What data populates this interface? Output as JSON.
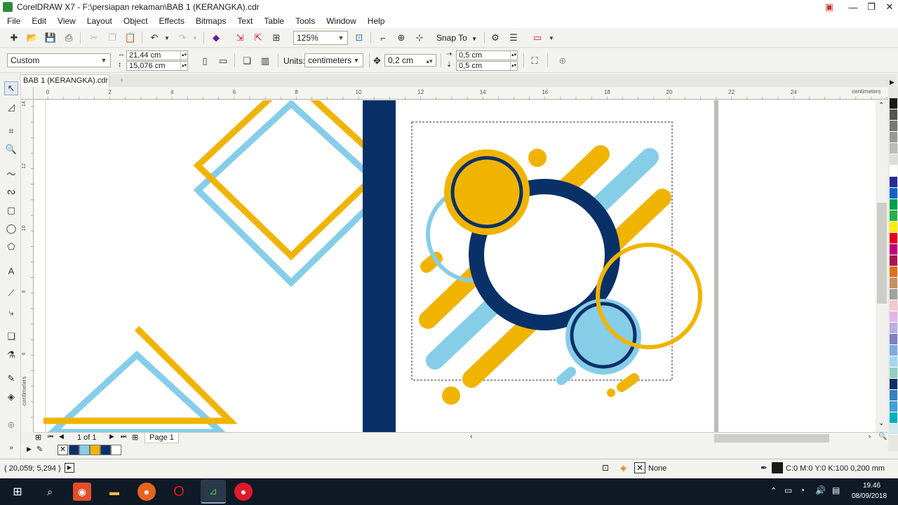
{
  "window": {
    "title": "CorelDRAW X7 - F:\\persiapan rekaman\\BAB 1 (KERANGKA).cdr",
    "minimize": "—",
    "maximize": "❐",
    "close": "✕"
  },
  "menu": [
    "File",
    "Edit",
    "View",
    "Layout",
    "Object",
    "Effects",
    "Bitmaps",
    "Text",
    "Table",
    "Tools",
    "Window",
    "Help"
  ],
  "toolbar": {
    "zoom_value": "125%",
    "snap_to": "Snap To"
  },
  "property_bar": {
    "page_size": "Custom",
    "width": "21,44 cm",
    "height": "15,076 cm",
    "units_label": "Units:",
    "units_value": "centimeters",
    "nudge": "0,2 cm",
    "dup_x": "0,5 cm",
    "dup_y": "0,5 cm"
  },
  "document_tab": "BAB 1 (KERANGKA).cdr",
  "ruler": {
    "h_ticks": [
      "0",
      "2",
      "4",
      "6",
      "8",
      "10",
      "12",
      "14",
      "16",
      "18",
      "20",
      "22",
      "24"
    ],
    "h_unit": "centimeters",
    "v_ticks": [
      "14",
      "12",
      "10",
      "8",
      "6"
    ],
    "v_unit": "centimeters"
  },
  "page_nav": {
    "count": "1 of 1",
    "page_name": "Page 1"
  },
  "status": {
    "coordinates": "( 20,059; 5,294 )",
    "fill": "None",
    "outline": "C:0 M:0 Y:0 K:100  0,200 mm"
  },
  "taskbar": {
    "time": "19.46",
    "date": "08/09/2018"
  },
  "colors": {
    "yellow": "#f0b400",
    "light_blue": "#86cde8",
    "navy": "#0a3068"
  },
  "palette": [
    "#1a1a1a",
    "#555555",
    "#777777",
    "#999999",
    "#bbbbbb",
    "#dddddd",
    "#ffffff",
    "#2a2a9a",
    "#1464c8",
    "#00a050",
    "#2ab04a",
    "#ffee00",
    "#e8001c",
    "#c0007a",
    "#aa1850",
    "#e07020",
    "#c89060",
    "#a0a0a0",
    "#f4c6d0",
    "#e0b8e8",
    "#b8b0e0",
    "#8080c0",
    "#80a8e0",
    "#a0d8f0",
    "#90d0c0",
    "#0a3068",
    "#3380c0",
    "#40a0d8",
    "#00b0c0",
    "#d0e8f0"
  ],
  "doc_palette": [
    "#0a3068",
    "#86cde8",
    "#f0b400",
    "#0a3068",
    "#ffffff"
  ]
}
